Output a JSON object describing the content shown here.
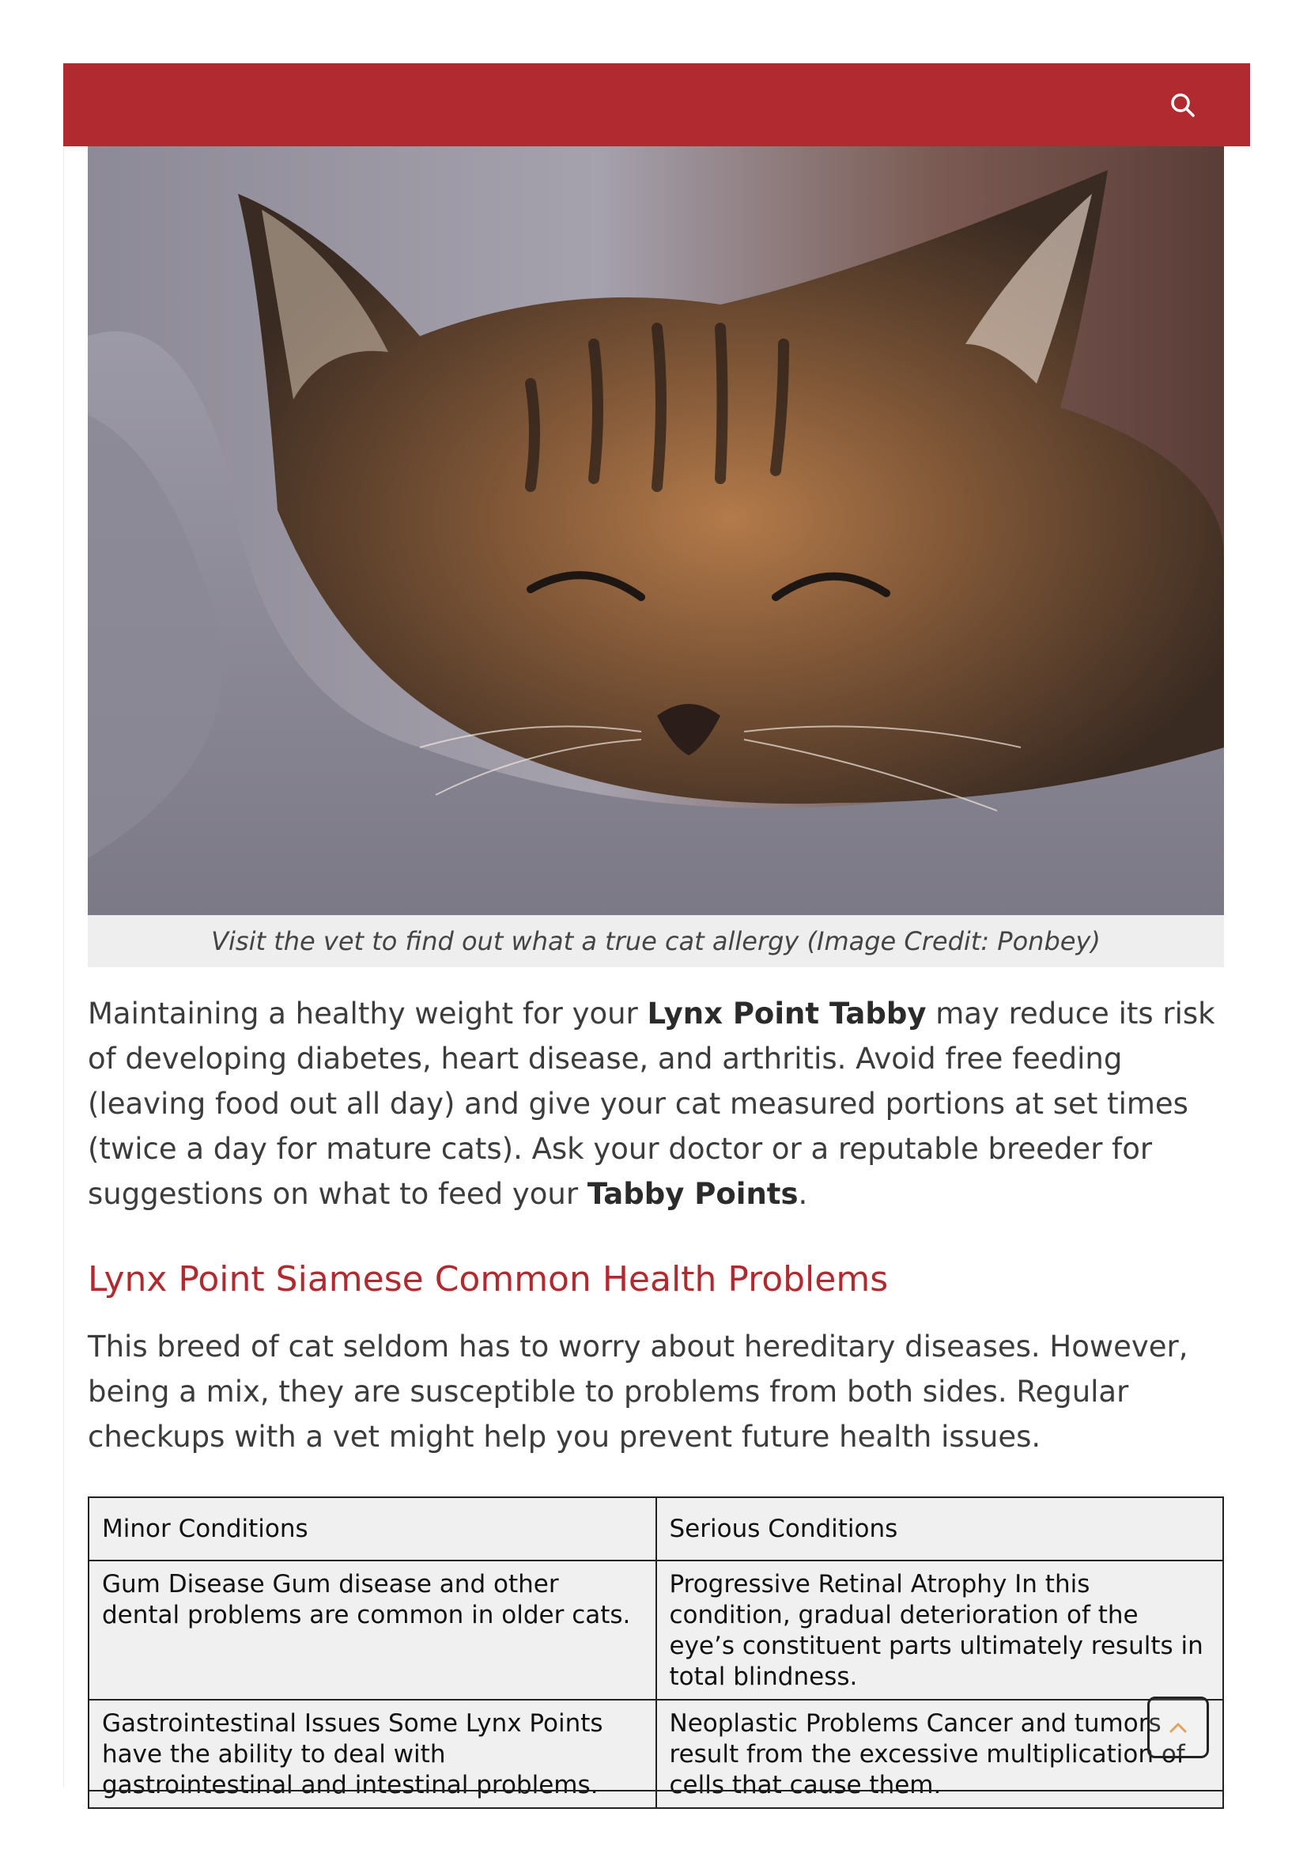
{
  "header": {
    "bar_color": "#b12a2f",
    "search_icon": "search-icon"
  },
  "hero": {
    "caption": "Visit the vet to find out what a true cat allergy (Image Credit: Ponbey)"
  },
  "article": {
    "para1": {
      "t1": "Maintaining a healthy weight for your ",
      "b1": "Lynx Point Tabby",
      "t2": " may reduce its risk of developing diabetes, heart disease, and arthritis. Avoid free feeding (leaving food out all day) and give your cat measured portions at set times (twice a day for mature cats). Ask your doctor or a reputable breeder for suggestions on what to feed your ",
      "b2": "Tabby Points",
      "t3": "."
    },
    "heading": "Lynx Point Siamese Common Health Problems",
    "para2": "This breed of cat seldom has to worry about hereditary diseases. However, being a mix, they are susceptible to problems from both sides. Regular checkups with a vet might help you prevent future health issues.",
    "table": {
      "headers": [
        "Minor Conditions",
        "Serious Conditions"
      ],
      "rows": [
        [
          "Gum Disease Gum disease and other dental problems are common in older cats.",
          "Progressive Retinal Atrophy In this condition, gradual deterioration of the eye’s constituent parts ultimately results in total blindness."
        ],
        [
          "Gastrointestinal Issues Some Lynx Points have the ability to deal with gastrointestinal and intestinal problems.",
          "Neoplastic Problems Cancer and tumors result from the excessive multiplication of cells that cause them."
        ]
      ]
    }
  },
  "scroll_top": {
    "icon": "chevron-up-icon",
    "accent": "#e0a25a"
  }
}
